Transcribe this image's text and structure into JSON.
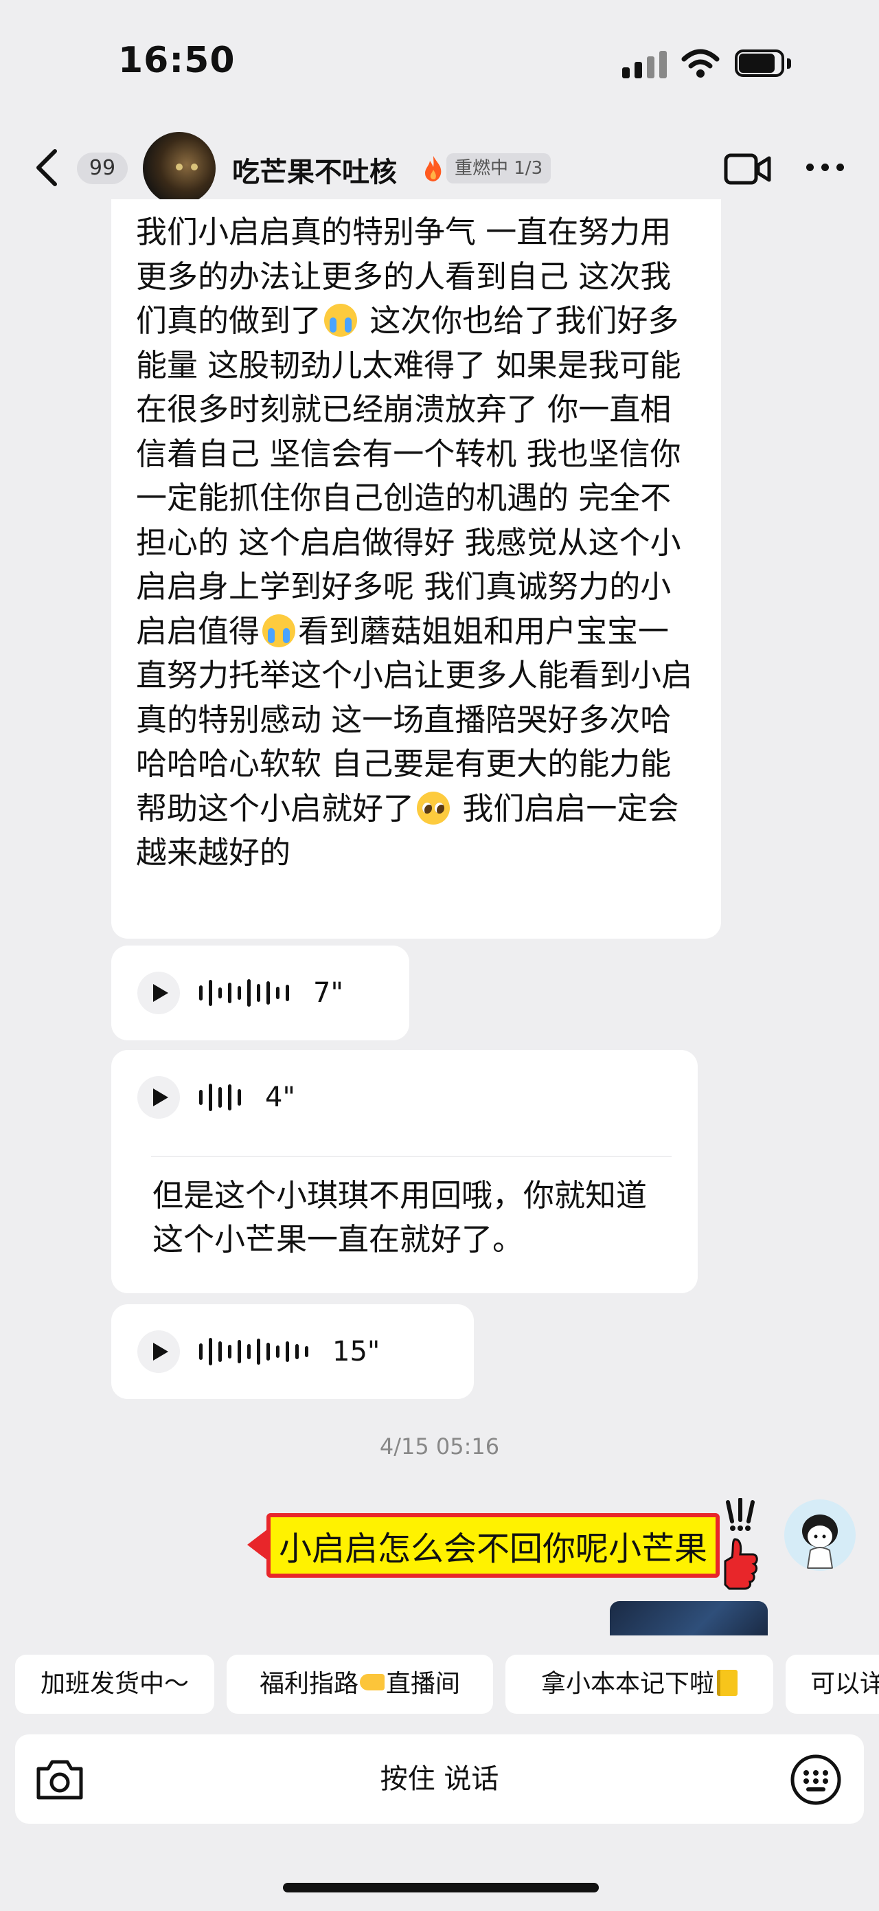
{
  "status_bar": {
    "time": "16:50"
  },
  "header": {
    "unread_count": "99",
    "chat_name": "吃芒果不吐核",
    "streak_label": "重燃中 1/3"
  },
  "messages": {
    "long_text_parts": [
      "我们小启启真的特别争气 一直在努力用更多的办法让更多的人看到自己 这次我们真的做到了",
      " 这次你也给了我们好多能量 这股韧劲儿太难得了 如果是我可能在很多时刻就已经崩溃放弃了 你一直相信着自己 坚信会有一个转机 我也坚信你一定能抓住你自己创造的机遇的 完全不担心的 这个启启做得好 我感觉从这个小启启身上学到好多呢 我们真诚努力的小启启值得",
      "看到蘑菇姐姐和用户宝宝一直努力托举这个小启让更多人能看到小启真的特别感动 这一场直播陪哭好多次哈哈哈哈心软软 自己要是有更大的能力能帮助这个小启就好了",
      " 我们启启一定会越来越好的"
    ],
    "voice_1": {
      "duration": "7\""
    },
    "voice_2": {
      "duration": "4\"",
      "transcript": "但是这个小琪琪不用回哦，你就知道这个小芒果一直在就好了。"
    },
    "voice_3": {
      "duration": "15\""
    },
    "timestamp": "4/15 05:16",
    "sticker_text": "小启启怎么会不回你呢小芒果"
  },
  "quick_replies": [
    {
      "text": "加班发货中～"
    },
    {
      "text_before": "福利指路",
      "text_after": "直播间"
    },
    {
      "text": "拿小本本记下啦"
    },
    {
      "text": "可以详"
    }
  ],
  "input_bar": {
    "hold_to_talk": "按住 说话"
  },
  "colors": {
    "background": "#eeeef0",
    "bubble": "#ffffff",
    "sticker_yellow": "#fff200",
    "sticker_red": "#e8262a"
  },
  "icons": [
    "back-icon",
    "flame-icon",
    "video-call-icon",
    "more-icon",
    "play-icon",
    "camera-icon",
    "emoji-panel-icon"
  ]
}
